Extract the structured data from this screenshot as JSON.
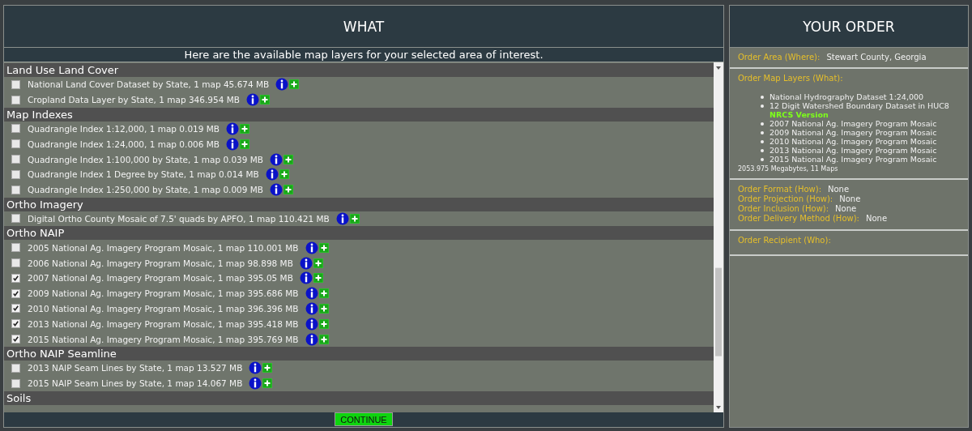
{
  "what": {
    "title": "WHAT",
    "subtitle": "Here are the available map layers for your selected area of interest.",
    "groups": [
      {
        "name": "Land Use Land Cover",
        "items": [
          {
            "label": "National Land Cover Dataset by State, 1 map 45.674 MB",
            "checked": false
          },
          {
            "label": "Cropland Data Layer by State, 1 map 346.954 MB",
            "checked": false
          }
        ]
      },
      {
        "name": "Map Indexes",
        "items": [
          {
            "label": "Quadrangle Index 1:12,000, 1 map 0.019 MB",
            "checked": false
          },
          {
            "label": "Quadrangle Index 1:24,000, 1 map 0.006 MB",
            "checked": false
          },
          {
            "label": "Quadrangle Index 1:100,000 by State, 1 map 0.039 MB",
            "checked": false
          },
          {
            "label": "Quadrangle Index 1 Degree by State, 1 map 0.014 MB",
            "checked": false
          },
          {
            "label": "Quadrangle Index 1:250,000 by State, 1 map 0.009 MB",
            "checked": false
          }
        ]
      },
      {
        "name": "Ortho Imagery",
        "items": [
          {
            "label": "Digital Ortho County Mosaic of 7.5' quads by APFO, 1 map 110.421 MB",
            "checked": false
          }
        ]
      },
      {
        "name": "Ortho NAIP",
        "items": [
          {
            "label": "2005 National Ag. Imagery Program Mosaic, 1 map 110.001 MB",
            "checked": false
          },
          {
            "label": "2006 National Ag. Imagery Program Mosaic, 1 map 98.898 MB",
            "checked": false
          },
          {
            "label": "2007 National Ag. Imagery Program Mosaic, 1 map 395.05 MB",
            "checked": true
          },
          {
            "label": "2009 National Ag. Imagery Program Mosaic, 1 map 395.686 MB",
            "checked": true
          },
          {
            "label": "2010 National Ag. Imagery Program Mosaic, 1 map 396.396 MB",
            "checked": true
          },
          {
            "label": "2013 National Ag. Imagery Program Mosaic, 1 map 395.418 MB",
            "checked": true
          },
          {
            "label": "2015 National Ag. Imagery Program Mosaic, 1 map 395.769 MB",
            "checked": true
          }
        ]
      },
      {
        "name": "Ortho NAIP Seamline",
        "items": [
          {
            "label": "2013 NAIP Seam Lines by State, 1 map 13.527 MB",
            "checked": false
          },
          {
            "label": "2015 NAIP Seam Lines by State, 1 map 14.067 MB",
            "checked": false
          }
        ]
      },
      {
        "name": "Soils"
      }
    ],
    "continue_button": "CONTINUE"
  },
  "order": {
    "title": "YOUR ORDER",
    "area": {
      "label": "Order Area (Where):",
      "value": "Stewart County, Georgia"
    },
    "layers": {
      "label": "Order Map Layers (What):",
      "items": [
        {
          "text": "National Hydrography Dataset 1:24,000"
        },
        {
          "text": "12 Digit Watershed Boundary Dataset in HUC8",
          "note": "NRCS Version"
        },
        {
          "text": "2007 National Ag. Imagery Program Mosaic"
        },
        {
          "text": "2009 National Ag. Imagery Program Mosaic"
        },
        {
          "text": "2010 National Ag. Imagery Program Mosaic"
        },
        {
          "text": "2013 National Ag. Imagery Program Mosaic"
        },
        {
          "text": "2015 National Ag. Imagery Program Mosaic"
        }
      ],
      "total": "2053.975 Megabytes, 11 Maps"
    },
    "how": [
      {
        "label": "Order Format (How):",
        "value": "None"
      },
      {
        "label": "Order Projection (How):",
        "value": "None"
      },
      {
        "label": "Order Inclusion (How):",
        "value": "None"
      },
      {
        "label": "Order Delivery Method (How):",
        "value": "None"
      }
    ],
    "recipient": {
      "label": "Order Recipient (Who):"
    }
  }
}
